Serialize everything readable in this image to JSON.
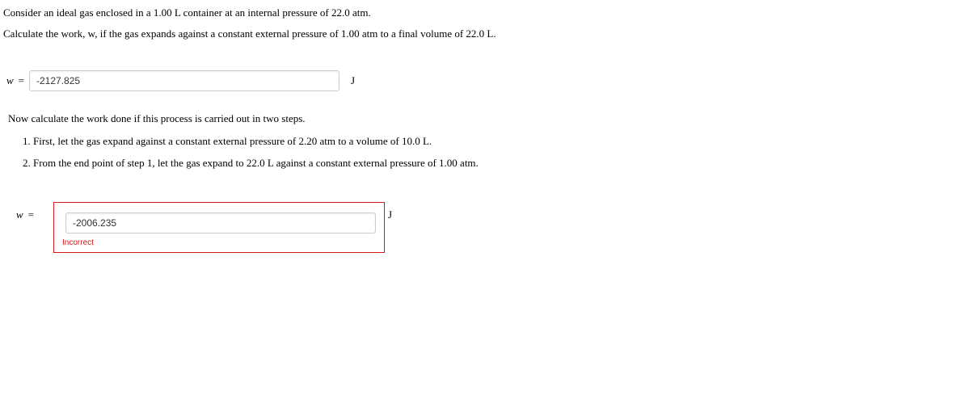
{
  "intro": {
    "line1": "Consider an ideal gas enclosed in a 1.00 L container at an internal pressure of 22.0 atm.",
    "line2": "Calculate the work, w, if the gas expands against a constant external pressure of 1.00 atm to a final volume of 22.0 L."
  },
  "answer1": {
    "var": "w",
    "eq": "=",
    "value": "-2127.825",
    "unit": "J"
  },
  "part2": {
    "intro": "Now calculate the work done if this process is carried out in two steps.",
    "steps": [
      "1. First, let the gas expand against a constant external pressure of 2.20 atm to a volume of 10.0 L.",
      "2. From the end point of step 1, let the gas expand to 22.0 L against a constant external pressure of 1.00 atm."
    ]
  },
  "answer2": {
    "var": "w",
    "eq": "=",
    "value": "-2006.235",
    "unit": "J",
    "feedback": "Incorrect"
  }
}
